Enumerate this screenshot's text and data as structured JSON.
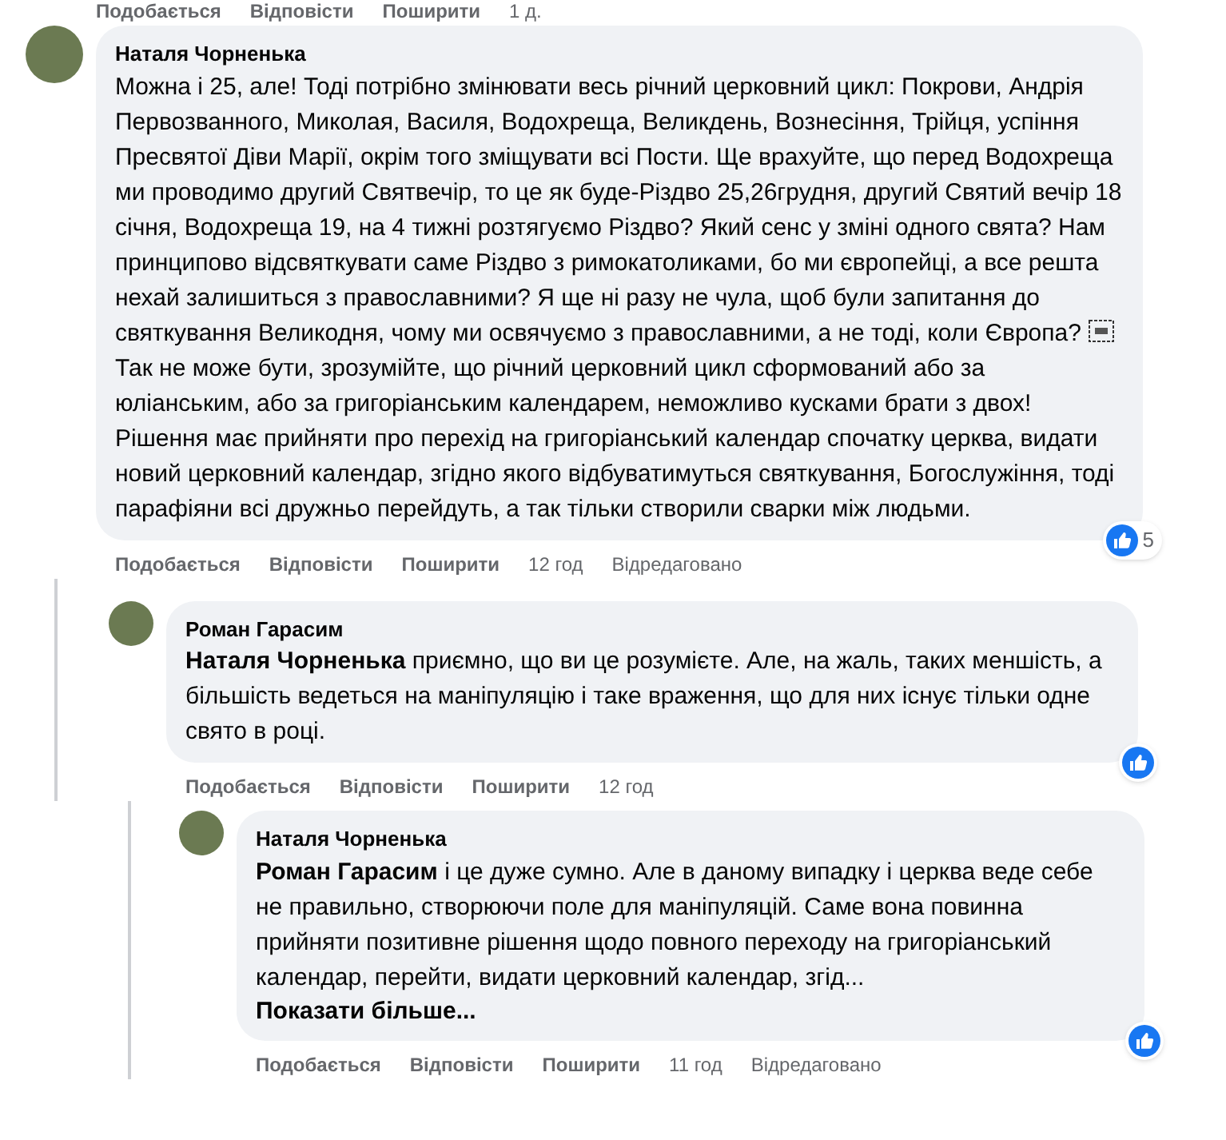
{
  "top_actions": {
    "like": "Подобається",
    "reply": "Відповісти",
    "share": "Поширити",
    "time": "1 д."
  },
  "comment": {
    "author": "Наталя Чорненька",
    "text": "Можна і 25, але! Тоді потрібно змінювати весь річний церковний цикл: Покрови, Андрія Первозванного, Миколая, Василя, Водохреща, Великдень, Вознесіння, Трійця, успіння Пресвятої Діви Марії, окрім того зміщувати всі Пости. Ще врахуйте, що перед Водохреща ми проводимо другий Святвечір, то це як буде-Різдво 25,26грудня, другий Святий вечір 18 січня, Водохреща 19, на 4 тижні розтягуємо Різдво? Який сенс у зміні одного свята? Нам принципово відсвяткувати саме Різдво з римокатоликами, бо ми європейці, а все решта нехай залишиться з православними? Я ще ні разу не чула, щоб були запитання до святкування Великодня, чому ми освячуємо з православними, а не тоді, коли Європа?",
    "text_after_icon": "Так не може бути, зрозумійте, що річний церковний цикл сформований або за юліанським, або за григоріанським календарем, неможливо кусками брати з двох! Рішення має прийняти про перехід на григоріанський календар спочатку церква, видати новий церковний календар, згідно якого відбуватимуться святкування, Богослужіння, тоді парафіяни всі дружньо перейдуть, а так тільки створили сварки між людьми.",
    "like": "Подобається",
    "reply": "Відповісти",
    "share": "Поширити",
    "time": "12 год",
    "edited": "Відредаговано",
    "reaction_count": "5",
    "children": [
      {
        "author": "Роман Гарасим",
        "mention": "Наталя Чорненька",
        "text": "приємно, що ви це розумієте. Але, на жаль, таких меншість, а більшість ведеться на маніпуляцію і таке враження, що для них існує тільки одне свято в році.",
        "like": "Подобається",
        "reply": "Відповісти",
        "share": "Поширити",
        "time": "12 год",
        "children": [
          {
            "author": "Наталя Чорненька",
            "mention": "Роман Гарасим",
            "text": "і це дуже сумно. Але в даному випадку і церква веде себе не правильно, створюючи поле для маніпуляцій. Саме вона повинна прийняти позитивне рішення щодо повного переходу на григоріанський календар, перейти, видати церковний календар, згід...",
            "see_more": "Показати більше...",
            "like": "Подобається",
            "reply": "Відповісти",
            "share": "Поширити",
            "time": "11 год",
            "edited": "Відредаговано"
          }
        ]
      }
    ]
  }
}
